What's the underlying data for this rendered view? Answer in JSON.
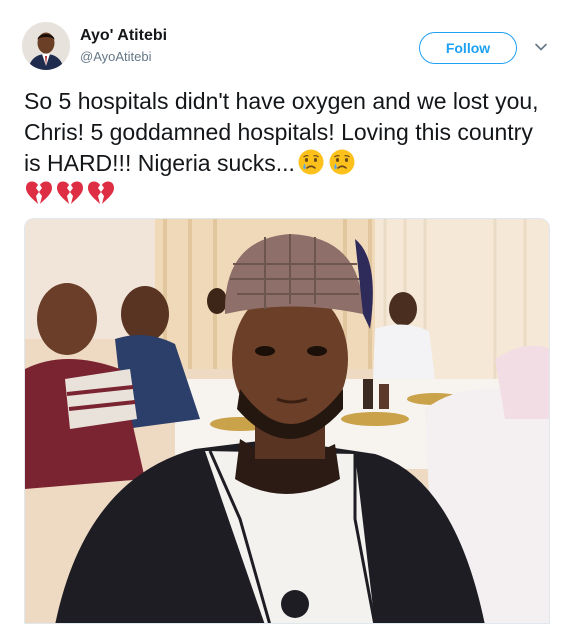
{
  "author": {
    "display_name": "Ayo' Atitebi",
    "handle": "@AyoAtitebi"
  },
  "follow_button": {
    "label": "Follow"
  },
  "tweet": {
    "text": "So 5 hospitals didn't have oxygen and we lost you, Chris! 5 goddamned hospitals! Loving this country is HARD!!! Nigeria sucks...",
    "emojis": [
      "crying-face",
      "crying-face"
    ],
    "hearts": [
      "broken-heart",
      "broken-heart",
      "broken-heart"
    ]
  },
  "colors": {
    "accent": "#1da1f2",
    "text_primary": "#14171a",
    "text_secondary": "#657786",
    "broken_heart": "#dd2e44",
    "emoji_face": "#fcc21b"
  },
  "media": {
    "icon": "photo-selfie"
  }
}
